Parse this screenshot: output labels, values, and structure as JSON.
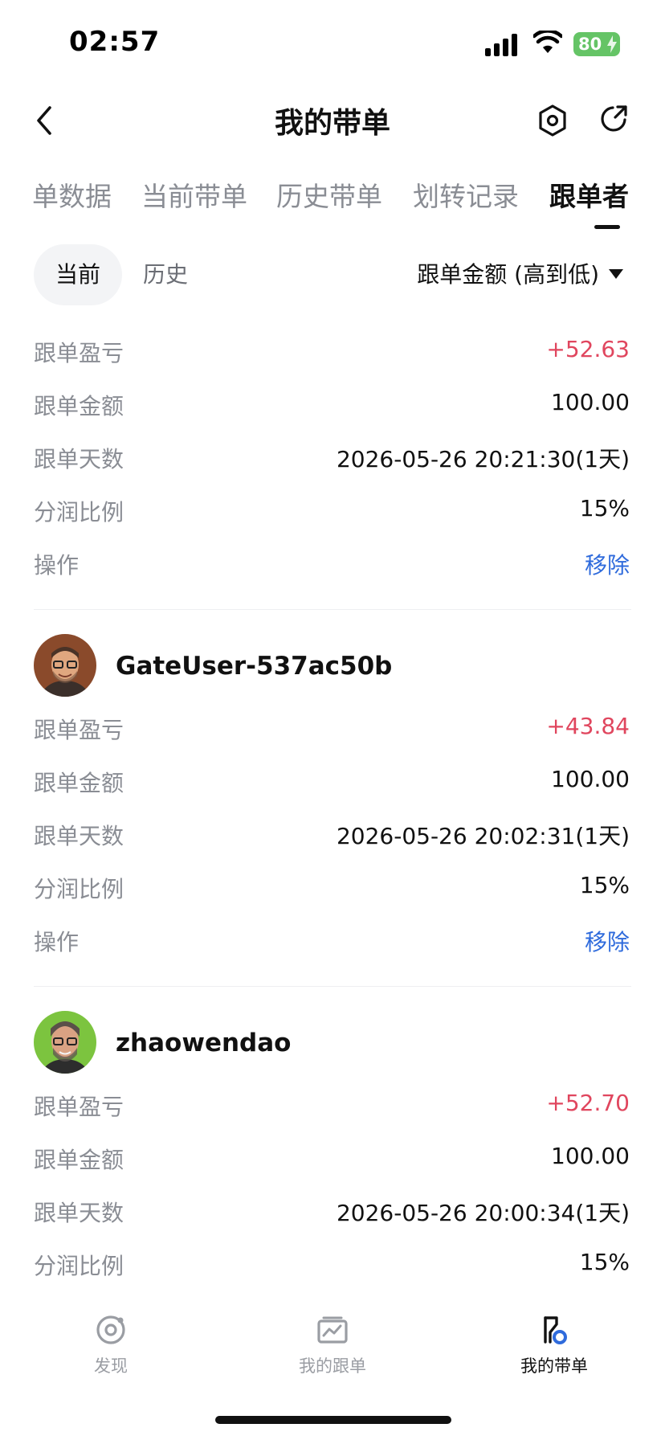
{
  "status_bar": {
    "time": "02:57",
    "battery": "80"
  },
  "nav": {
    "title": "我的带单"
  },
  "tabs": [
    {
      "label": "单数据"
    },
    {
      "label": "当前带单"
    },
    {
      "label": "历史带单"
    },
    {
      "label": "划转记录"
    },
    {
      "label": "跟单者",
      "active": true
    }
  ],
  "filter": {
    "current_label": "当前",
    "history_label": "历史",
    "sort_label": "跟单金额 (高到低)"
  },
  "followers": [
    {
      "username": "",
      "rows": [
        {
          "label": "跟单盈亏",
          "value": "+52.63"
        },
        {
          "label": "跟单金额",
          "value": "100.00"
        },
        {
          "label": "跟单天数",
          "value": "2026-05-26 20:21:30(1天)"
        },
        {
          "label": "分润比例",
          "value": "15%"
        },
        {
          "label": "操作",
          "value": "移除"
        }
      ]
    },
    {
      "username": "GateUser-537ac50b",
      "avatar_bg": "#8a4a2b",
      "rows": [
        {
          "label": "跟单盈亏",
          "value": "+43.84"
        },
        {
          "label": "跟单金额",
          "value": "100.00"
        },
        {
          "label": "跟单天数",
          "value": "2026-05-26 20:02:31(1天)"
        },
        {
          "label": "分润比例",
          "value": "15%"
        },
        {
          "label": "操作",
          "value": "移除"
        }
      ]
    },
    {
      "username": "zhaowendao",
      "avatar_bg": "#7cc43f",
      "rows": [
        {
          "label": "跟单盈亏",
          "value": "+52.70"
        },
        {
          "label": "跟单金额",
          "value": "100.00"
        },
        {
          "label": "跟单天数",
          "value": "2026-05-26 20:00:34(1天)"
        },
        {
          "label": "分润比例",
          "value": "15%"
        }
      ]
    }
  ],
  "bottom_nav": [
    {
      "label": "发现",
      "icon": "discover-icon"
    },
    {
      "label": "我的跟单",
      "icon": "chart-card-icon"
    },
    {
      "label": "我的带单",
      "icon": "lead-flag-icon",
      "active": true
    }
  ],
  "colors": {
    "profit": "#e0465e",
    "action": "#2f6bdc",
    "battery": "#65c466"
  }
}
